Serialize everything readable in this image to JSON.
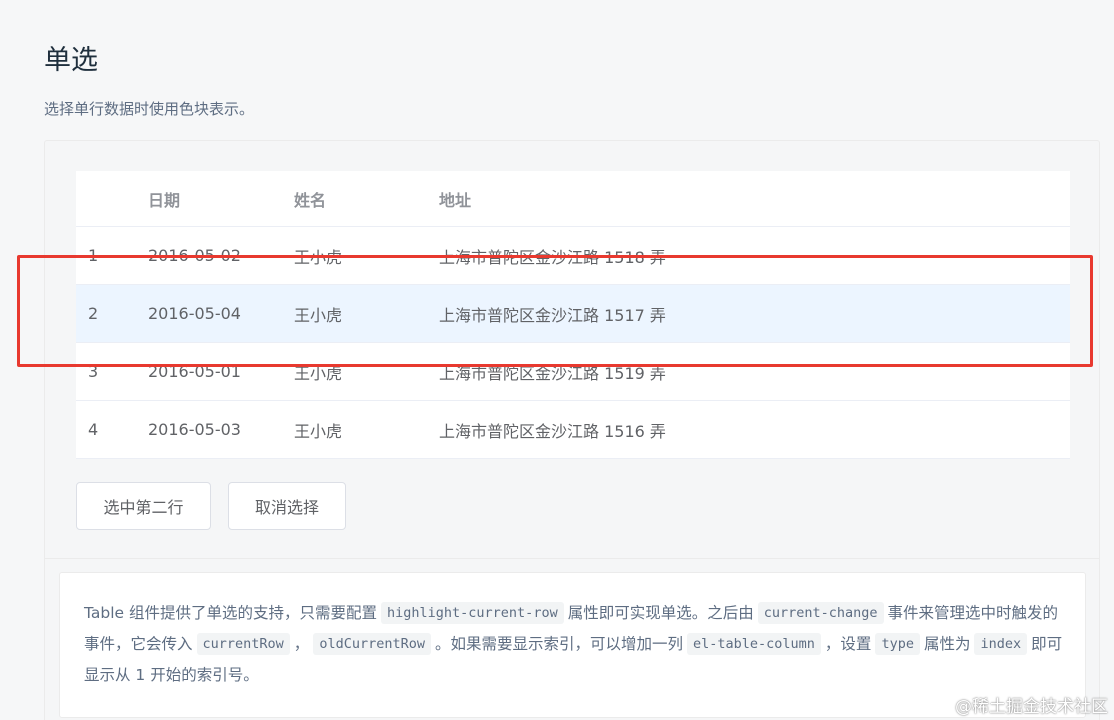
{
  "page": {
    "title": "单选",
    "subtitle": "选择单行数据时使用色块表示。"
  },
  "table": {
    "columns": [
      "",
      "日期",
      "姓名",
      "地址"
    ],
    "rows": [
      {
        "index": "1",
        "date": "2016-05-02",
        "name": "王小虎",
        "address": "上海市普陀区金沙江路 1518 弄"
      },
      {
        "index": "2",
        "date": "2016-05-04",
        "name": "王小虎",
        "address": "上海市普陀区金沙江路 1517 弄"
      },
      {
        "index": "3",
        "date": "2016-05-01",
        "name": "王小虎",
        "address": "上海市普陀区金沙江路 1519 弄"
      },
      {
        "index": "4",
        "date": "2016-05-03",
        "name": "王小虎",
        "address": "上海市普陀区金沙江路 1516 弄"
      }
    ],
    "current_row": 2
  },
  "buttons": {
    "select_second": "选中第二行",
    "cancel": "取消选择"
  },
  "description": {
    "t1": "Table 组件提供了单选的支持，只需要配置",
    "c1": "highlight-current-row",
    "t2": "属性即可实现单选。之后由",
    "c2": "current-change",
    "t3": "事件来管理选中时触发的事件，它会传入",
    "c3": "currentRow",
    "t4": "，",
    "c4": "oldCurrentRow",
    "t5": "。如果需要显示索引，可以增加一列",
    "c5": "el-table-column",
    "t6": "，设置",
    "c6": "type",
    "t7": "属性为",
    "c7": "index",
    "t8": "即可显示从 1 开始的索引号。"
  },
  "watermark": "@稀土掘金技术社区",
  "colors": {
    "highlight_row": "#ecf5ff",
    "annotation_border": "#e8392f"
  }
}
